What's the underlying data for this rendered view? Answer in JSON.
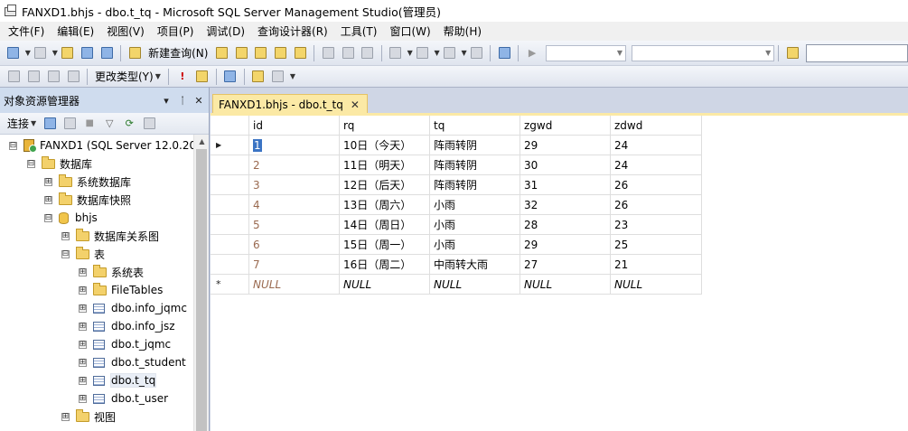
{
  "window": {
    "title": "FANXD1.bhjs - dbo.t_tq - Microsoft SQL Server Management Studio(管理员)"
  },
  "menu": [
    "文件(F)",
    "编辑(E)",
    "视图(V)",
    "项目(P)",
    "调试(D)",
    "查询设计器(R)",
    "工具(T)",
    "窗口(W)",
    "帮助(H)"
  ],
  "toolbar": {
    "new_query_label": "新建查询(N)",
    "change_type_label": "更改类型(Y)"
  },
  "object_explorer": {
    "title": "对象资源管理器",
    "pin_label": "▾ ᛙ ✕",
    "connect_label": "连接",
    "nodes": [
      {
        "label": "FANXD1 (SQL Server 12.0.20",
        "expander": "⊟"
      },
      {
        "label": "数据库",
        "expander": "⊟"
      },
      {
        "label": "系统数据库",
        "expander": "⊞"
      },
      {
        "label": "数据库快照",
        "expander": "⊞"
      },
      {
        "label": "bhjs",
        "expander": "⊟"
      },
      {
        "label": "数据库关系图",
        "expander": "⊞"
      },
      {
        "label": "表",
        "expander": "⊟"
      },
      {
        "label": "系统表",
        "expander": "⊞"
      },
      {
        "label": "FileTables",
        "expander": "⊞"
      },
      {
        "label": "dbo.info_jqmc",
        "expander": "⊞"
      },
      {
        "label": "dbo.info_jsz",
        "expander": "⊞"
      },
      {
        "label": "dbo.t_jqmc",
        "expander": "⊞"
      },
      {
        "label": "dbo.t_student",
        "expander": "⊞"
      },
      {
        "label": "dbo.t_tq",
        "expander": "⊞"
      },
      {
        "label": "dbo.t_user",
        "expander": "⊞"
      },
      {
        "label": "视图",
        "expander": "⊞"
      }
    ]
  },
  "document": {
    "tab_label": "FANXD1.bhjs - dbo.t_tq"
  },
  "grid": {
    "columns": [
      "id",
      "rq",
      "tq",
      "zgwd",
      "zdwd"
    ],
    "rows": [
      [
        "1",
        "10日（今天）",
        "阵雨转阴",
        "29",
        "24"
      ],
      [
        "2",
        "11日（明天）",
        "阵雨转阴",
        "30",
        "24"
      ],
      [
        "3",
        "12日（后天）",
        "阵雨转阴",
        "31",
        "26"
      ],
      [
        "4",
        "13日（周六）",
        "小雨",
        "32",
        "26"
      ],
      [
        "5",
        "14日（周日）",
        "小雨",
        "28",
        "23"
      ],
      [
        "6",
        "15日（周一）",
        "小雨",
        "29",
        "25"
      ],
      [
        "7",
        "16日（周二）",
        "中雨转大雨",
        "27",
        "21"
      ]
    ],
    "new_row": [
      "NULL",
      "NULL",
      "NULL",
      "NULL",
      "NULL"
    ]
  },
  "colors": {
    "selection": "#3b74c4",
    "tab_active": "#fbe9a5",
    "panel_header": "#cfdcee"
  }
}
